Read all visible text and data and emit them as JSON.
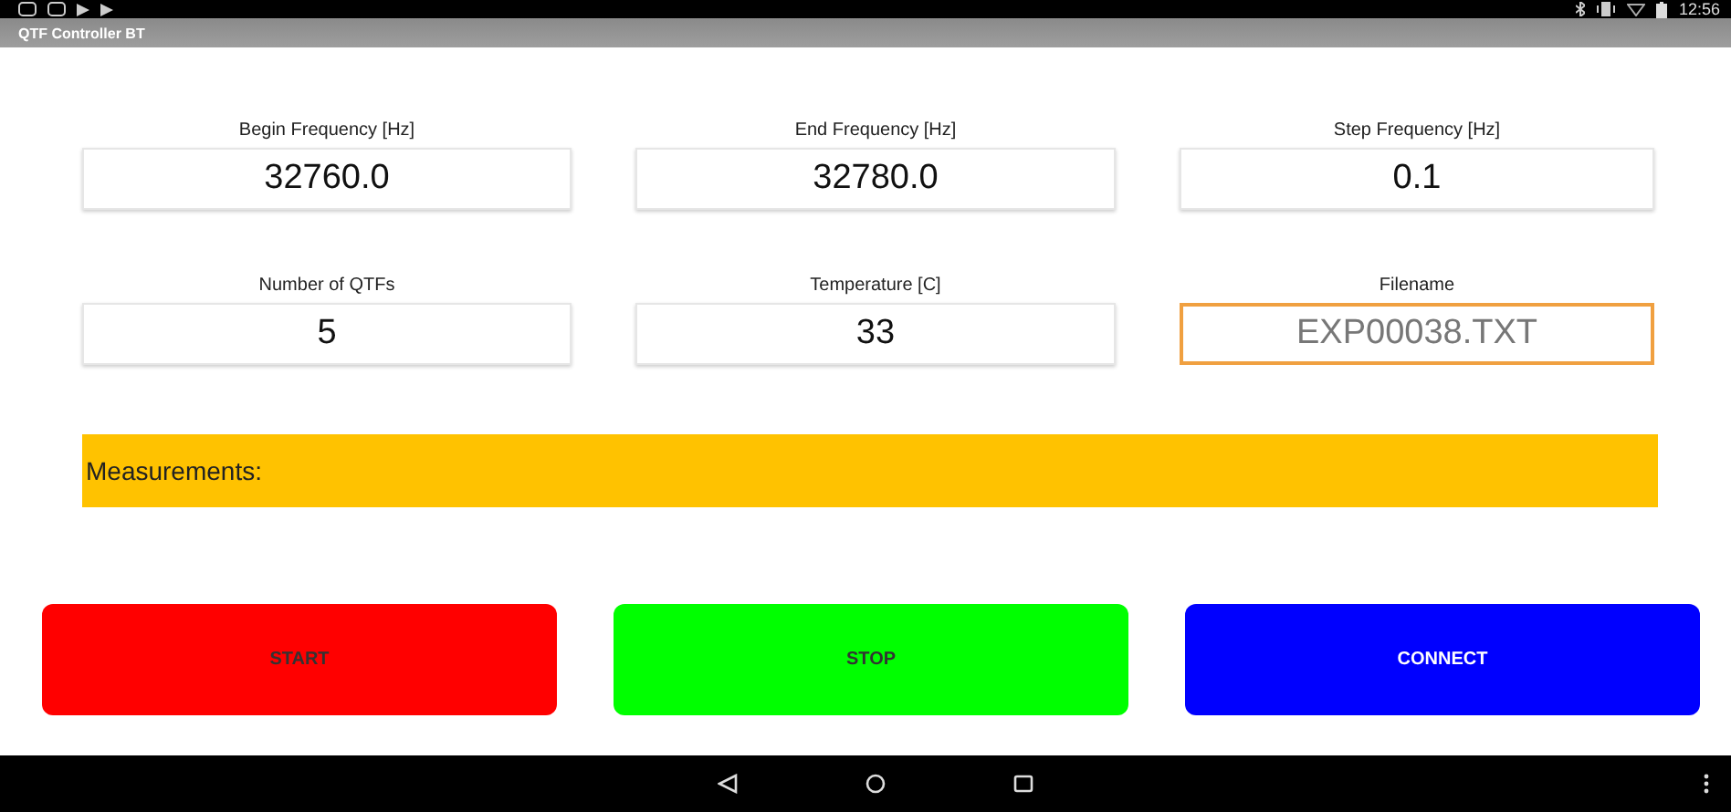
{
  "status_bar": {
    "time": "12:56"
  },
  "window": {
    "title": "QTF Controller BT"
  },
  "fields": [
    {
      "label": "Begin Frequency [Hz]",
      "value": "32760.0",
      "focused": false
    },
    {
      "label": "End Frequency [Hz]",
      "value": "32780.0",
      "focused": false
    },
    {
      "label": "Step Frequency [Hz]",
      "value": "0.1",
      "focused": false
    },
    {
      "label": "Number of QTFs",
      "value": "5",
      "focused": false
    },
    {
      "label": "Temperature [C]",
      "value": "33",
      "focused": false
    },
    {
      "label": "Filename",
      "placeholder": "EXP00038.TXT",
      "focused": true
    }
  ],
  "measurements": {
    "label": "Measurements:"
  },
  "buttons": [
    {
      "label": "START",
      "color": "#ff0000",
      "disabled": true
    },
    {
      "label": "STOP",
      "color": "#00ff00",
      "disabled": true
    },
    {
      "label": "CONNECT",
      "color": "#0000ff",
      "disabled": false
    }
  ]
}
